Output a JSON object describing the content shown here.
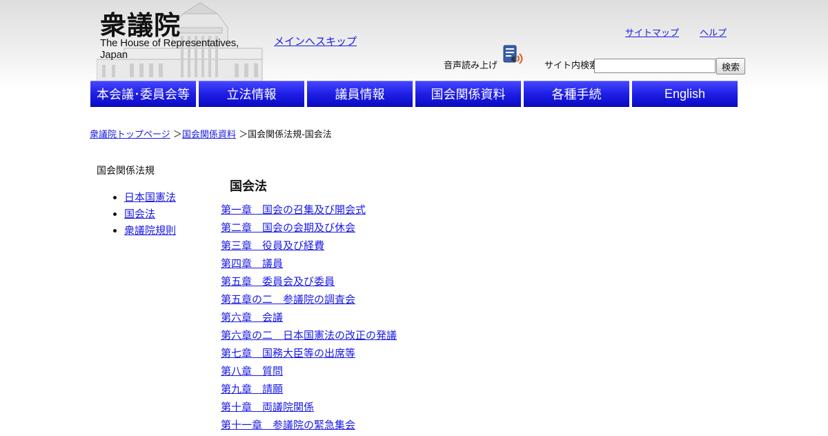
{
  "header": {
    "logo_title": "衆議院",
    "logo_subtitle": "The House of Representatives, Japan",
    "skip_link": "メインへスキップ",
    "sitemap_link": "サイトマップ",
    "help_link": "ヘルプ",
    "voice_label": "音声読み上げ",
    "search_label": "サイト内検索",
    "search_value": "",
    "search_button": "検索"
  },
  "nav": {
    "items": [
      {
        "label": "本会議･委員会等"
      },
      {
        "label": "立法情報"
      },
      {
        "label": "議員情報"
      },
      {
        "label": "国会関係資料"
      },
      {
        "label": "各種手続"
      },
      {
        "label": "English"
      }
    ]
  },
  "breadcrumb": {
    "items": [
      {
        "label": "衆議院トップページ"
      },
      {
        "label": "国会関係資料"
      },
      {
        "label": "国会関係法規-国会法"
      }
    ],
    "separator": "＞"
  },
  "sidebar": {
    "heading": "国会関係法規",
    "items": [
      {
        "label": "日本国憲法"
      },
      {
        "label": "国会法"
      },
      {
        "label": "衆議院規則"
      }
    ]
  },
  "main": {
    "title": "国会法",
    "chapters": [
      {
        "label": "第一章　国会の召集及び開会式"
      },
      {
        "label": "第二章　国会の会期及び休会"
      },
      {
        "label": "第三章　役員及び経費"
      },
      {
        "label": "第四章　議員"
      },
      {
        "label": "第五章　委員会及び委員"
      },
      {
        "label": "第五章の二　参議院の調査会"
      },
      {
        "label": "第六章　会議"
      },
      {
        "label": "第六章の二　日本国憲法の改正の発議"
      },
      {
        "label": "第七章　国務大臣等の出席等"
      },
      {
        "label": "第八章　質問"
      },
      {
        "label": "第九章　請願"
      },
      {
        "label": "第十章　両議院関係"
      },
      {
        "label": "第十一章　参議院の緊急集会"
      }
    ]
  },
  "colors": {
    "link": "#1a1ae6",
    "nav_bg": "#1f1fe6",
    "nav_text": "#ffffff"
  }
}
